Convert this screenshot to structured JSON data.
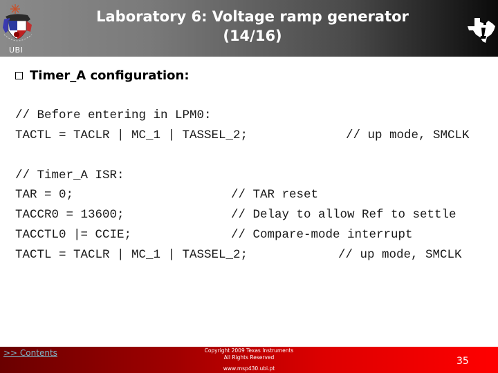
{
  "header": {
    "title_line1": "Laboratory 6: Voltage ramp generator",
    "title_line2": "(14/16)",
    "left_logo": {
      "icon": "university-crest-icon",
      "label": "UBI"
    },
    "right_logo": {
      "icon": "texas-instruments-logo-icon"
    }
  },
  "content": {
    "heading": "Timer_A configuration:",
    "heading_bullet_icon": "hollow-square-bullet-icon",
    "block1": [
      {
        "code": "// Before entering in LPM0:",
        "comment": ""
      },
      {
        "code": "TACTL = TACLR | MC_1 | TASSEL_2;",
        "comment": "// up mode, SMCLK"
      }
    ],
    "block2": [
      {
        "code": "// Timer_A ISR:",
        "comment": ""
      },
      {
        "code": "TAR = 0;",
        "comment": "// TAR reset"
      },
      {
        "code": "TACCR0 = 13600;",
        "comment": "// Delay to allow Ref to settle"
      },
      {
        "code": "TACCTL0 |= CCIE;",
        "comment": "// Compare-mode interrupt"
      },
      {
        "code": "TACTL = TACLR | MC_1 | TASSEL_2;",
        "comment": "// up mode, SMCLK"
      }
    ]
  },
  "footer": {
    "contents_link": ">> Contents",
    "copyright_line1": "Copyright  2009 Texas Instruments",
    "copyright_line2": "All Rights Reserved",
    "url": "www.msp430.ubi.pt",
    "page_number": "35"
  },
  "colors": {
    "footer_red": "#ff0000",
    "footer_dark_red": "#6a0000",
    "header_dark": "#0a0a0a",
    "header_gray": "#8a8a8a",
    "link": "#7fb6c8"
  }
}
